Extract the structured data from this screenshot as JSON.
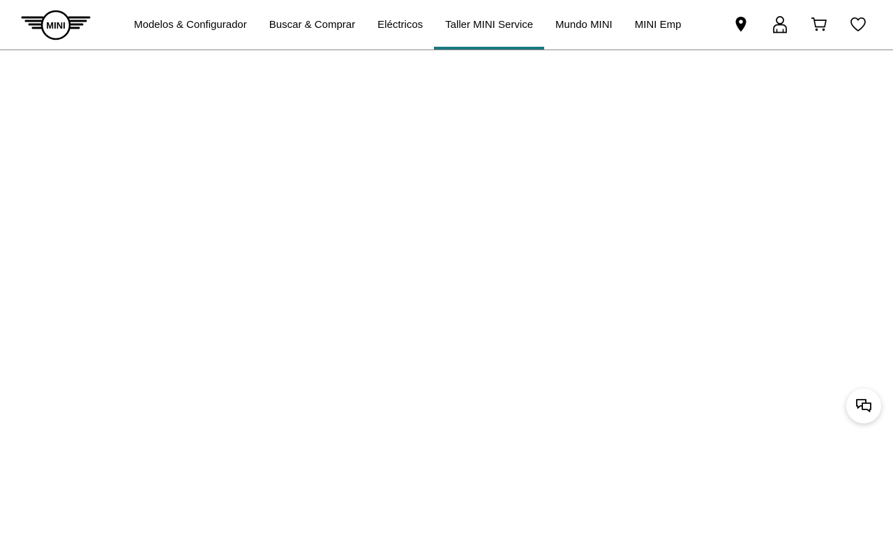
{
  "brand": {
    "logo_text": "MINI"
  },
  "nav": {
    "items": [
      {
        "label": "Modelos & Configurador",
        "active": false
      },
      {
        "label": "Buscar & Comprar",
        "active": false
      },
      {
        "label": "Eléctricos",
        "active": false
      },
      {
        "label": "Taller MINI Service",
        "active": true
      },
      {
        "label": "Mundo MINI",
        "active": false
      },
      {
        "label": "MINI Empre",
        "active": false
      }
    ]
  },
  "header_icons": [
    "location-pin-icon",
    "user-icon",
    "cart-icon",
    "heart-icon"
  ],
  "chat": {
    "icon": "chat-bubbles-icon"
  },
  "colors": {
    "accent": "#1a7a80",
    "header_border": "#8a8a8a",
    "text": "#000000",
    "background": "#ffffff"
  }
}
